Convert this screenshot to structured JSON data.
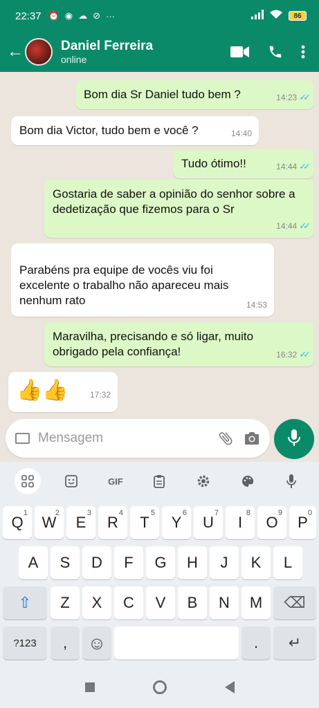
{
  "statusbar": {
    "time": "22:37",
    "battery": "86"
  },
  "header": {
    "back": "←",
    "contact_name": "Daniel Ferreira",
    "contact_status": "online"
  },
  "messages": [
    {
      "text": "Bom dia Sr Daniel tudo bem ?",
      "time": "14:23",
      "direction": "out",
      "ticks": "✓✓"
    },
    {
      "text": "Bom dia Victor, tudo bem e você ?",
      "time": "14:40",
      "direction": "in"
    },
    {
      "text": "Tudo ótimo!!",
      "time": "14:44",
      "direction": "out",
      "ticks": "✓✓"
    },
    {
      "text": "Gostaria de saber a opinião do senhor sobre a dedetização que fizemos para o Sr",
      "time": "14:44",
      "direction": "out",
      "ticks": "✓✓"
    },
    {
      "text": "Parabéns pra equipe de vocês viu foi excelente o trabalho não apareceu mais nenhum rato",
      "time": "14:53",
      "direction": "in"
    },
    {
      "text": "Maravilha, precisando e só ligar, muito obrigado pela confiança!",
      "time": "16:32",
      "direction": "out",
      "ticks": "✓✓"
    },
    {
      "text": "👍👍",
      "time": "17:32",
      "direction": "in"
    }
  ],
  "composer": {
    "placeholder": "Mensagem"
  },
  "keyboard_toolbar": {
    "gif": "GIF"
  },
  "keyboard": {
    "row1": [
      {
        "k": "Q",
        "n": "1"
      },
      {
        "k": "W",
        "n": "2"
      },
      {
        "k": "E",
        "n": "3"
      },
      {
        "k": "R",
        "n": "4"
      },
      {
        "k": "T",
        "n": "5"
      },
      {
        "k": "Y",
        "n": "6"
      },
      {
        "k": "U",
        "n": "7"
      },
      {
        "k": "I",
        "n": "8"
      },
      {
        "k": "O",
        "n": "9"
      },
      {
        "k": "P",
        "n": "0"
      }
    ],
    "row2": [
      "A",
      "S",
      "D",
      "F",
      "G",
      "H",
      "J",
      "K",
      "L"
    ],
    "row3": [
      "Z",
      "X",
      "C",
      "V",
      "B",
      "N",
      "M"
    ],
    "shift": "⇧",
    "backspace": "⌫",
    "numbers": "?123",
    "comma": ",",
    "emoji": "☺",
    "period": ".",
    "enter": "↵"
  }
}
